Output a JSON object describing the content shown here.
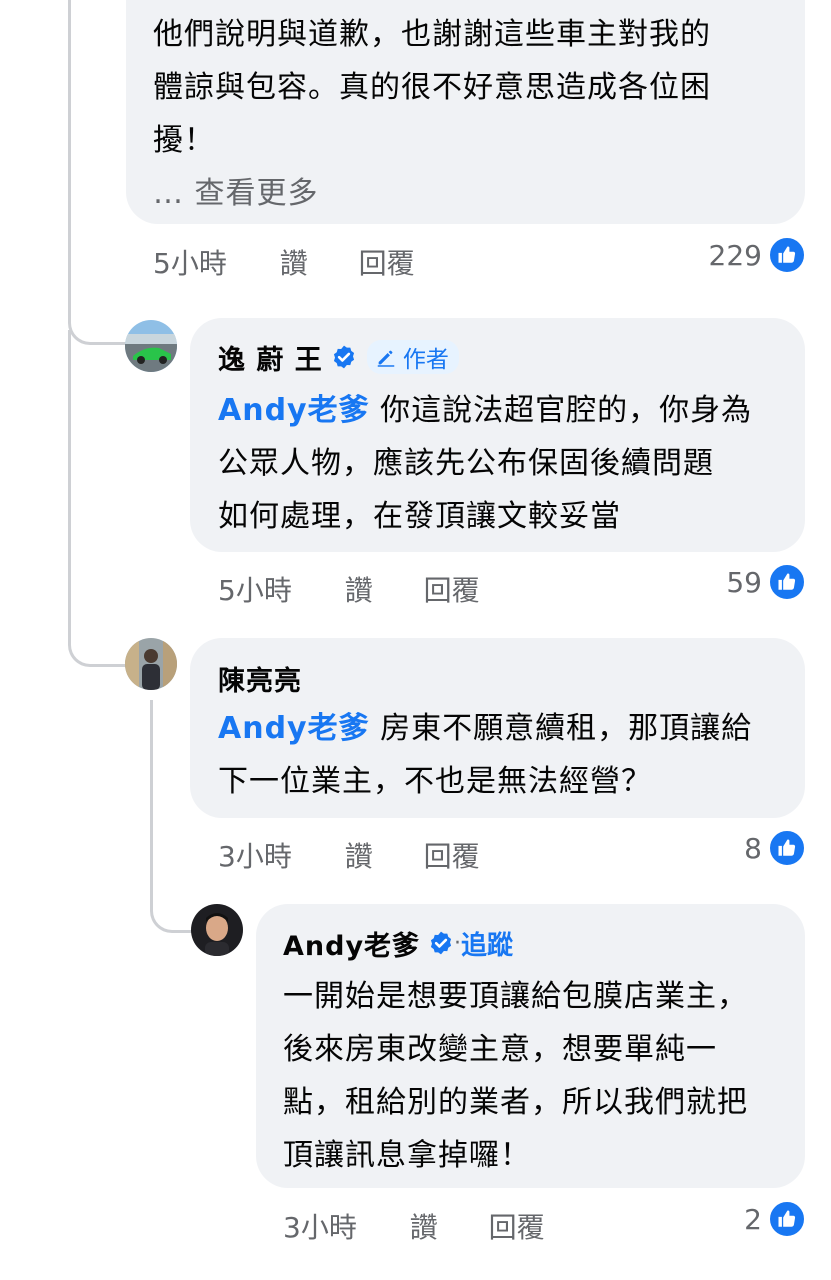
{
  "comments": [
    {
      "text_lines": [
        "他們說明與道歉，也謝謝這些車主對我的",
        "體諒與包容。真的很不好意思造成各位困",
        "擾！"
      ],
      "see_more": "… 查看更多",
      "time": "5小時",
      "like_label": "讚",
      "reply_label": "回覆",
      "reaction_count": "229"
    },
    {
      "author": "逸 蔚 王",
      "author_badge": "作者",
      "mention": "Andy老爹",
      "text_first": " 你這說法超官腔的，你身為",
      "text_lines": [
        "公眾人物，應該先公布保固後續問題",
        "如何處理，在發頂讓文較妥當"
      ],
      "time": "5小時",
      "like_label": "讚",
      "reply_label": "回覆",
      "reaction_count": "59"
    },
    {
      "author": "陳亮亮",
      "mention": "Andy老爹",
      "text_first": " 房東不願意續租，那頂讓給",
      "text_lines": [
        "下一位業主，不也是無法經營？"
      ],
      "time": "3小時",
      "like_label": "讚",
      "reply_label": "回覆",
      "reaction_count": "8"
    },
    {
      "author": "Andy老爹",
      "separator": " · ",
      "follow_label": "追蹤",
      "text_lines": [
        "一開始是想要頂讓給包膜店業主，",
        "後來房東改變主意，想要單純一",
        "點，租給別的業者，所以我們就把",
        "頂讓訊息拿掉囉！"
      ],
      "time": "3小時",
      "like_label": "讚",
      "reply_label": "回覆",
      "reaction_count": "2"
    }
  ],
  "colors": {
    "bubble": "#f0f2f5",
    "accent": "#1877f2",
    "meta": "#65676b",
    "line": "#ced0d4"
  }
}
